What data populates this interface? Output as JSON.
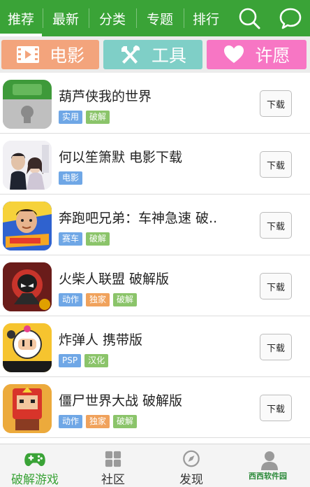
{
  "top_tabs": [
    {
      "label": "推荐",
      "active": true
    },
    {
      "label": "最新",
      "active": false
    },
    {
      "label": "分类",
      "active": false
    },
    {
      "label": "专题",
      "active": false
    },
    {
      "label": "排行",
      "active": false
    }
  ],
  "top_icons": [
    "search-icon",
    "chat-bubble-icon"
  ],
  "categories": [
    {
      "label": "电影",
      "icon": "film-icon",
      "color": "#f3a47c"
    },
    {
      "label": "工具",
      "icon": "tools-icon",
      "color": "#7fcfc7"
    },
    {
      "label": "许愿",
      "icon": "heart-icon",
      "color": "#f776c4"
    }
  ],
  "download_label": "下载",
  "apps": [
    {
      "title": "葫芦侠我的世界",
      "tags": [
        {
          "text": "实用",
          "color": "#6fa7e6"
        },
        {
          "text": "破解",
          "color": "#8bc46a"
        }
      ]
    },
    {
      "title": "何以笙箫默  电影下载",
      "tags": [
        {
          "text": "电影",
          "color": "#6fa7e6"
        }
      ]
    },
    {
      "title": "奔跑吧兄弟：车神急速  破..",
      "tags": [
        {
          "text": "赛车",
          "color": "#6fa7e6"
        },
        {
          "text": "破解",
          "color": "#8bc46a"
        }
      ]
    },
    {
      "title": "火柴人联盟  破解版",
      "tags": [
        {
          "text": "动作",
          "color": "#6fa7e6"
        },
        {
          "text": "独家",
          "color": "#f0a25c"
        },
        {
          "text": "破解",
          "color": "#8bc46a"
        }
      ]
    },
    {
      "title": "炸弹人  携带版",
      "tags": [
        {
          "text": "PSP",
          "color": "#6fa7e6"
        },
        {
          "text": "汉化",
          "color": "#8bc46a"
        }
      ]
    },
    {
      "title": "僵尸世界大战  破解版",
      "tags": [
        {
          "text": "动作",
          "color": "#6fa7e6"
        },
        {
          "text": "独家",
          "color": "#f0a25c"
        },
        {
          "text": "破解",
          "color": "#8bc46a"
        }
      ]
    }
  ],
  "bottom_nav": [
    {
      "label": "破解游戏",
      "icon": "gamepad-icon",
      "active": true
    },
    {
      "label": "社区",
      "icon": "grid-icon",
      "active": false
    },
    {
      "label": "发现",
      "icon": "compass-icon",
      "active": false
    },
    {
      "label": "",
      "icon": "user-icon",
      "active": false
    }
  ],
  "watermark": "西西软件园",
  "colors": {
    "brand": "#3aa337",
    "active_nav": "#3aa337",
    "inactive_nav": "#9a9a9a"
  }
}
